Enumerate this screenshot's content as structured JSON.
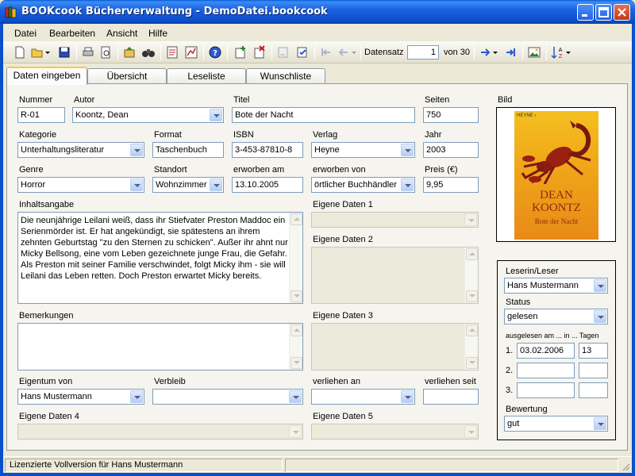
{
  "window": {
    "title": "BOOKcook Bücherverwaltung - DemoDatei.bookcook"
  },
  "menu": {
    "items": [
      "Datei",
      "Bearbeiten",
      "Ansicht",
      "Hilfe"
    ]
  },
  "toolbar": {
    "record_label": "Datensatz",
    "record_value": "1",
    "record_of": "von 30"
  },
  "tabs": [
    {
      "label": "Daten eingeben",
      "active": true
    },
    {
      "label": "Übersicht",
      "active": false
    },
    {
      "label": "Leseliste",
      "active": false
    },
    {
      "label": "Wunschliste",
      "active": false
    }
  ],
  "form": {
    "nummer": {
      "label": "Nummer",
      "value": "R-01"
    },
    "autor": {
      "label": "Autor",
      "value": "Koontz, Dean"
    },
    "titel": {
      "label": "Titel",
      "value": "Bote der Nacht"
    },
    "seiten": {
      "label": "Seiten",
      "value": "750"
    },
    "kategorie": {
      "label": "Kategorie",
      "value": "Unterhaltungsliteratur"
    },
    "format": {
      "label": "Format",
      "value": "Taschenbuch"
    },
    "isbn": {
      "label": "ISBN",
      "value": "3-453-87810-8"
    },
    "verlag": {
      "label": "Verlag",
      "value": "Heyne"
    },
    "jahr": {
      "label": "Jahr",
      "value": "2003"
    },
    "genre": {
      "label": "Genre",
      "value": "Horror"
    },
    "standort": {
      "label": "Standort",
      "value": "Wohnzimmer"
    },
    "erworben_am": {
      "label": "erworben am",
      "value": "13.10.2005"
    },
    "erworben_von": {
      "label": "erworben von",
      "value": "örtlicher Buchhändler"
    },
    "preis": {
      "label": "Preis (€)",
      "value": "9,95"
    },
    "inhaltsangabe": {
      "label": "Inhaltsangabe",
      "value": "Die neunjährige Leilani weiß, dass ihr Stiefvater Preston Maddoc ein Serienmörder ist. Er hat angekündigt, sie spätestens an ihrem zehnten Geburtstag \"zu den Sternen zu schicken\". Außer ihr ahnt nur Micky Bellsong, eine vom Leben gezeichnete junge Frau, die Gefahr. Als Preston mit seiner Familie verschwindet, folgt Micky ihm - sie will Leilani das Leben retten. Doch Preston erwartet Micky bereits."
    },
    "eigene_daten_1": {
      "label": "Eigene Daten 1",
      "value": ""
    },
    "eigene_daten_2": {
      "label": "Eigene Daten 2",
      "value": ""
    },
    "bemerkungen": {
      "label": "Bemerkungen",
      "value": ""
    },
    "eigene_daten_3": {
      "label": "Eigene Daten 3",
      "value": ""
    },
    "eigentum_von": {
      "label": "Eigentum von",
      "value": "Hans Mustermann"
    },
    "verbleib": {
      "label": "Verbleib",
      "value": ""
    },
    "verliehen_an": {
      "label": "verliehen an",
      "value": ""
    },
    "verliehen_seit": {
      "label": "verliehen seit",
      "value": ""
    },
    "eigene_daten_4": {
      "label": "Eigene Daten 4",
      "value": ""
    },
    "eigene_daten_5": {
      "label": "Eigene Daten 5",
      "value": ""
    }
  },
  "image": {
    "label": "Bild",
    "cover": {
      "publisher": "HEYNE ‹",
      "author_line1": "DEAN",
      "author_line2": "KOONTZ",
      "subtitle": "Bote der Nacht"
    }
  },
  "reader": {
    "leser_label": "Leserin/Leser",
    "leser_value": "Hans Mustermann",
    "status_label": "Status",
    "status_value": "gelesen",
    "read_header": "ausgelesen am ... in ... Tagen",
    "rows": [
      {
        "num": "1.",
        "date": "03.02.2006",
        "days": "13"
      },
      {
        "num": "2.",
        "date": "",
        "days": ""
      },
      {
        "num": "3.",
        "date": "",
        "days": ""
      }
    ],
    "bewertung_label": "Bewertung",
    "bewertung_value": "gut"
  },
  "statusbar": {
    "text": "Lizenzierte Vollversion für Hans Mustermann"
  },
  "colors": {
    "titlebar": "#0a4fcc",
    "panel": "#f5f4ee",
    "active_tab_accent": "#ffc83c"
  }
}
